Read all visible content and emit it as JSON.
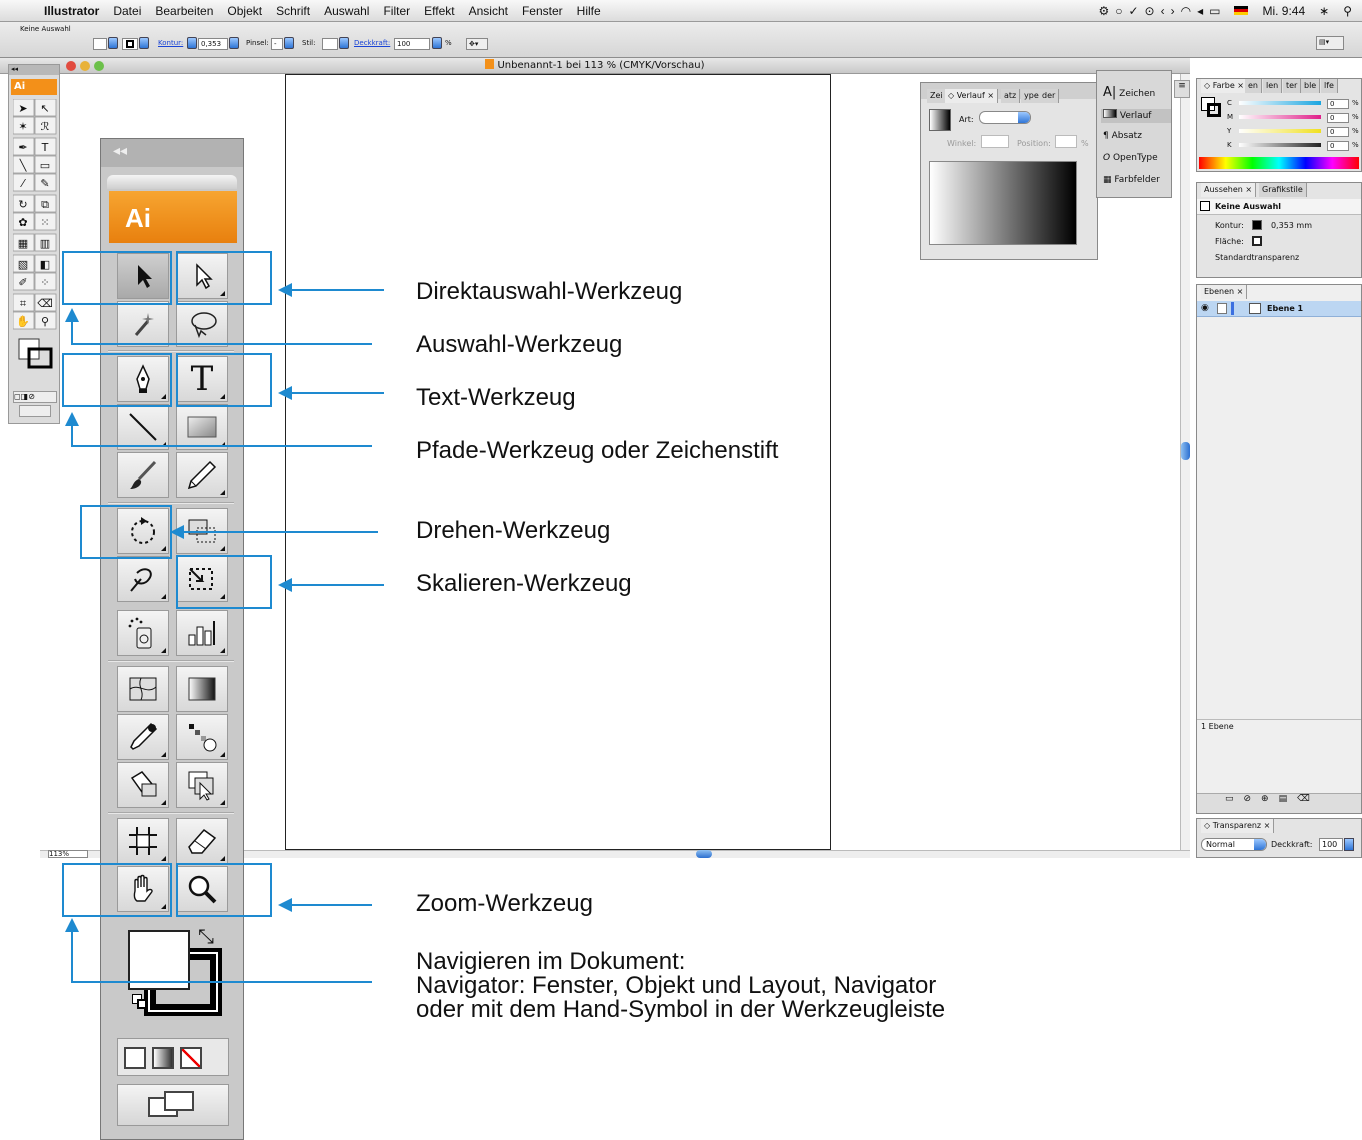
{
  "menubar": {
    "app": "Illustrator",
    "items": [
      "Datei",
      "Bearbeiten",
      "Objekt",
      "Schrift",
      "Auswahl",
      "Filter",
      "Effekt",
      "Ansicht",
      "Fenster",
      "Hilfe"
    ],
    "clock": "Mi. 9:44"
  },
  "controlbar": {
    "selection": "Keine Auswahl",
    "stroke_label": "Kontur:",
    "stroke_value": "0,353",
    "brush_label": "Pinsel:",
    "brush_value": "-",
    "style_label": "Stil:",
    "opacity_label": "Deckkraft:",
    "opacity_value": "100",
    "percent": "%"
  },
  "document": {
    "title": "Unbenannt-1 bei 113 % (CMYK/Vorschau)",
    "zoom": "113%"
  },
  "toolbox": {
    "logo": "Ai",
    "collapse": "◂◂"
  },
  "panels": {
    "gradient": {
      "tabs": [
        "Zei",
        "Verlauf",
        "atz",
        "ype",
        "der"
      ],
      "type_label": "Art:",
      "angle_label": "Winkel:",
      "position_label": "Position:",
      "percent": "%"
    },
    "dock": {
      "items": [
        "Zeichen",
        "Verlauf",
        "Absatz",
        "OpenType",
        "Farbfelder"
      ]
    },
    "color": {
      "tabs": [
        "Farbe",
        "en",
        "len",
        "ter",
        "ble",
        "lfe"
      ],
      "channels": [
        {
          "label": "C",
          "value": "0",
          "color": "#1aa5e0"
        },
        {
          "label": "M",
          "value": "0",
          "color": "#e0208a"
        },
        {
          "label": "Y",
          "value": "0",
          "color": "#f0e020"
        },
        {
          "label": "K",
          "value": "0",
          "color": "#222222"
        }
      ],
      "percent": "%"
    },
    "appearance": {
      "tabs": [
        "Aussehen",
        "Grafikstile"
      ],
      "header": "Keine Auswahl",
      "rows": [
        {
          "label": "Kontur:",
          "value": "0,353 mm"
        },
        {
          "label": "Fläche:",
          "value": ""
        },
        {
          "label": "Standardtransparenz",
          "value": ""
        }
      ]
    },
    "layers": {
      "tab": "Ebenen",
      "layer_name": "Ebene 1",
      "footer": "1 Ebene"
    },
    "transparency": {
      "tab": "Transparenz",
      "mode": "Normal",
      "opacity_label": "Deckkraft:",
      "opacity_value": "100"
    }
  },
  "annotations": {
    "direct_selection": "Direktauswahl-Werkzeug",
    "selection": "Auswahl-Werkzeug",
    "text": "Text-Werkzeug",
    "pen": "Pfade-Werkzeug oder Zeichenstift",
    "rotate": "Drehen-Werkzeug",
    "scale": "Skalieren-Werkzeug",
    "zoom": "Zoom-Werkzeug",
    "navigate_1": "Navigieren im Dokument:",
    "navigate_2": "Navigator: Fenster, Objekt und Layout, Navigator",
    "navigate_3": "oder mit dem Hand-Symbol in der Werkzeugleiste"
  },
  "colors": {
    "accent": "#1e8ad0",
    "ai_orange": "#f39019",
    "layer_highlight": "#bcd6f2"
  }
}
